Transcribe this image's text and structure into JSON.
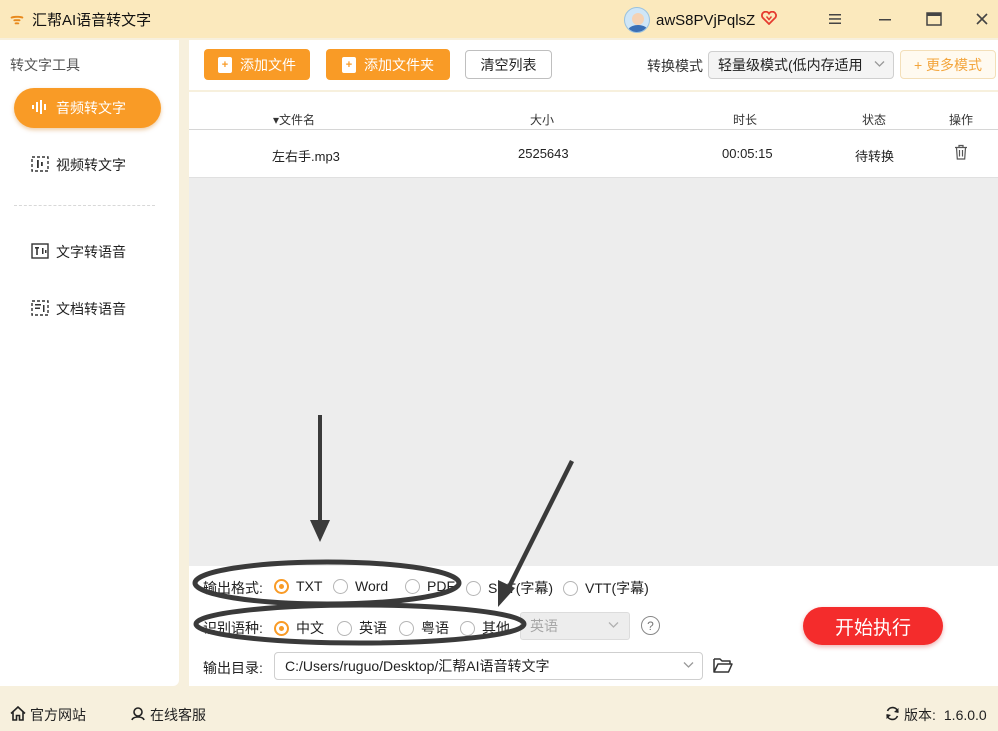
{
  "titlebar": {
    "app_title": "汇帮AI语音转文字",
    "username": "awS8PVjPqlsZ",
    "icons": [
      "app-logo-icon",
      "avatar",
      "vip-heart-icon",
      "menu-icon",
      "minimize-icon",
      "maximize-icon",
      "close-icon"
    ]
  },
  "sidebar": {
    "heading": "转文字工具",
    "items": [
      {
        "label": "音频转文字",
        "icon": "audio-wave-icon",
        "active": true
      },
      {
        "label": "视频转文字",
        "icon": "video-wave-icon",
        "active": false
      },
      {
        "label": "文字转语音",
        "icon": "text-to-speech-icon",
        "active": false
      },
      {
        "label": "文档转语音",
        "icon": "doc-to-speech-icon",
        "active": false
      }
    ]
  },
  "toolbar": {
    "add_file": "添加文件",
    "add_folder": "添加文件夹",
    "clear_list": "清空列表",
    "mode_label": "转换模式",
    "mode_value": "轻量级模式(低内存适用",
    "more_modes": "+ 更多模式"
  },
  "table": {
    "columns": [
      "▾文件名",
      "大小",
      "时长",
      "状态",
      "操作"
    ],
    "rows": [
      {
        "name": "左右手.mp3",
        "size": "2525643",
        "duration": "00:05:15",
        "status": "待转换"
      }
    ]
  },
  "settings": {
    "format_label": "输出格式:",
    "formats": [
      "TXT",
      "Word",
      "PDF",
      "SRT(字幕)",
      "VTT(字幕)"
    ],
    "format_selected": "TXT",
    "lang_label": "识别语种:",
    "languages": [
      "中文",
      "英语",
      "粤语",
      "其他"
    ],
    "lang_selected": "中文",
    "other_lang_value": "英语",
    "help": "?",
    "start_button": "开始执行",
    "dir_label": "输出目录:",
    "dir_value": "C:/Users/ruguo/Desktop/汇帮AI语音转文字"
  },
  "statusbar": {
    "website": "官方网站",
    "support": "在线客服",
    "version_label": "版本:",
    "version": "1.6.0.0"
  },
  "colors": {
    "accent": "#f99b26",
    "start": "#f42c2c",
    "titlebar": "#fbe9bd",
    "annotation": "#3a3a3a"
  }
}
